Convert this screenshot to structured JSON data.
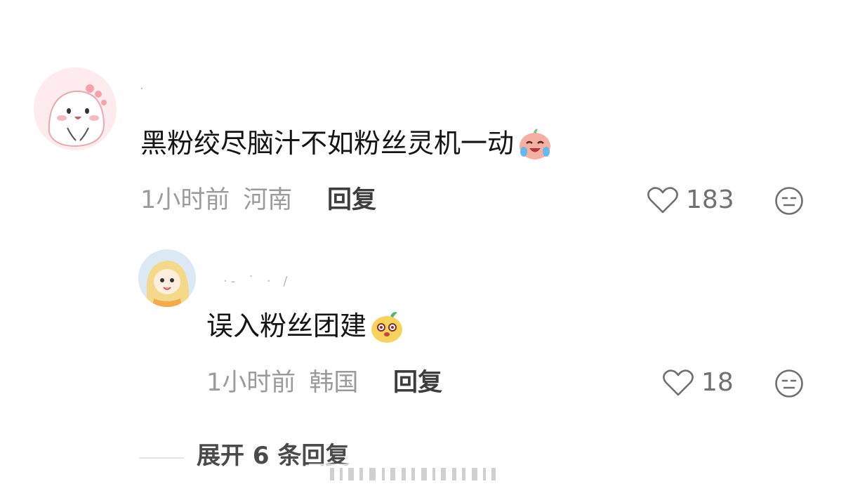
{
  "comments": [
    {
      "username": "·",
      "text": "黑粉绞尽脑汁不如粉丝灵机一动",
      "emoji": "crying-laughing-emoji",
      "time": "1小时前",
      "location": "河南",
      "reply_label": "回复",
      "likes": "183"
    },
    {
      "username": "· ̵ ˙ ·  /",
      "text": "误入粉丝团建",
      "emoji": "surprised-sprout-emoji",
      "time": "1小时前",
      "location": "韩国",
      "reply_label": "回复",
      "likes": "18"
    }
  ],
  "expand_replies": "展开 6 条回复",
  "colors": {
    "text": "#141414",
    "meta": "#9b9b9b",
    "icon": "#6f6f6f"
  }
}
